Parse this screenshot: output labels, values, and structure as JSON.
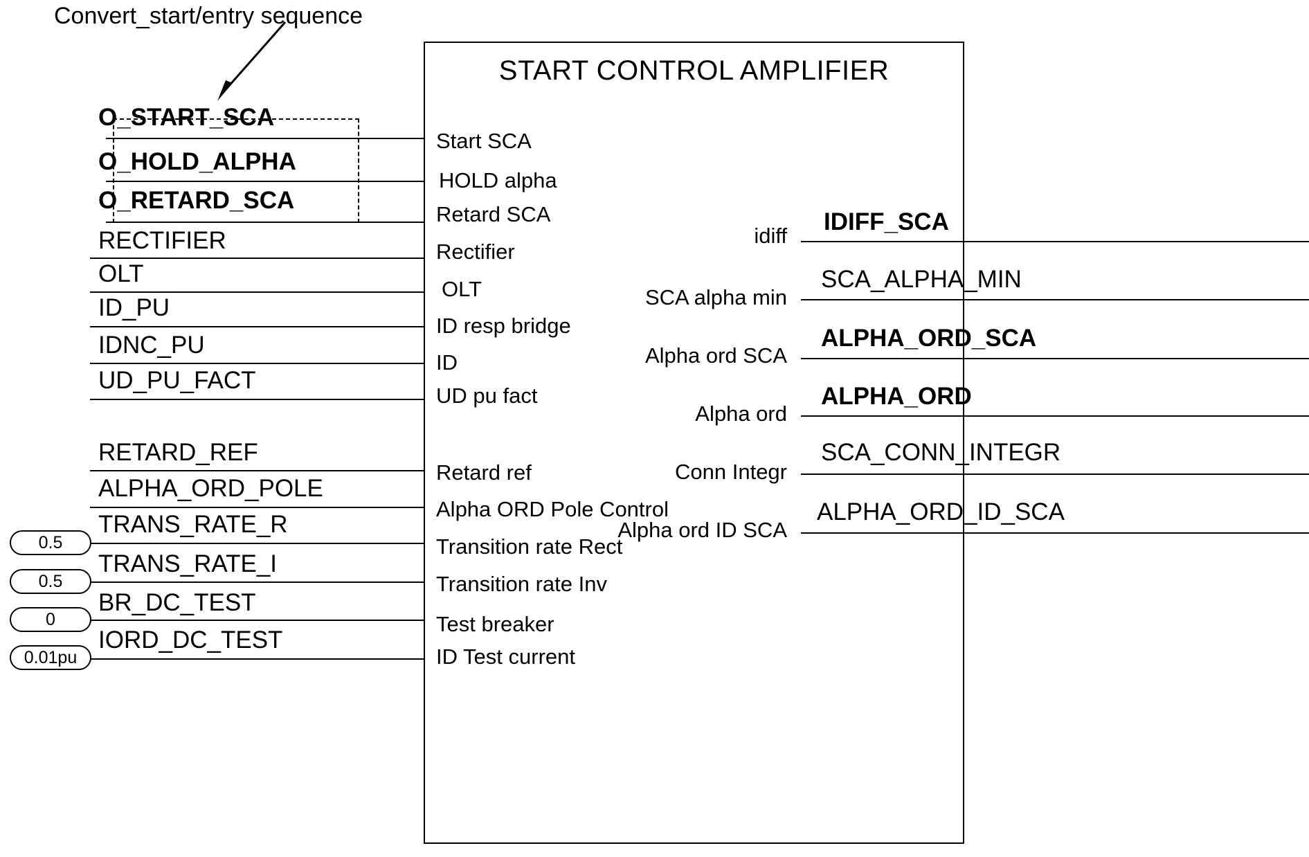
{
  "annotation": {
    "text": "Convert_start/entry sequence"
  },
  "block": {
    "title": "START CONTROL AMPLIFIER"
  },
  "inputs": [
    {
      "signal": "O_START_SCA",
      "port": "Start SCA",
      "bold": true,
      "grouped": true
    },
    {
      "signal": "O_HOLD_ALPHA",
      "port": "HOLD alpha",
      "bold": true,
      "grouped": true
    },
    {
      "signal": "O_RETARD_SCA",
      "port": "Retard SCA",
      "bold": true,
      "grouped": true
    },
    {
      "signal": "RECTIFIER",
      "port": "Rectifier",
      "bold": false,
      "grouped": false
    },
    {
      "signal": "OLT",
      "port": "OLT",
      "bold": false,
      "grouped": false
    },
    {
      "signal": "ID_PU",
      "port": "ID resp bridge",
      "bold": false,
      "grouped": false
    },
    {
      "signal": "IDNC_PU",
      "port": "ID",
      "bold": false,
      "grouped": false
    },
    {
      "signal": "UD_PU_FACT",
      "port": "UD pu fact",
      "bold": false,
      "grouped": false
    },
    {
      "signal": "RETARD_REF",
      "port": "Retard ref",
      "bold": false,
      "grouped": false
    },
    {
      "signal": "ALPHA_ORD_POLE",
      "port": "Alpha ORD Pole Control",
      "bold": false,
      "grouped": false
    },
    {
      "signal": "TRANS_RATE_R",
      "port": "Transition rate Rect",
      "bold": false,
      "grouped": false,
      "value": "0.5"
    },
    {
      "signal": "TRANS_RATE_I",
      "port": "Transition rate Inv",
      "bold": false,
      "grouped": false,
      "value": "0.5"
    },
    {
      "signal": "BR_DC_TEST",
      "port": "Test breaker",
      "bold": false,
      "grouped": false,
      "value": "0"
    },
    {
      "signal": "IORD_DC_TEST",
      "port": "ID Test current",
      "bold": false,
      "grouped": false,
      "value": "0.01pu"
    }
  ],
  "outputs": [
    {
      "signal": "IDIFF_SCA",
      "port": "idiff",
      "bold": true
    },
    {
      "signal": "SCA_ALPHA_MIN",
      "port": "SCA alpha min",
      "bold": false
    },
    {
      "signal": "ALPHA_ORD_SCA",
      "port": "Alpha ord SCA",
      "bold": true
    },
    {
      "signal": "ALPHA_ORD",
      "port": "Alpha ord",
      "bold": true
    },
    {
      "signal": "SCA_CONN_INTEGR",
      "port": "Conn Integr",
      "bold": false
    },
    {
      "signal": "ALPHA_ORD_ID_SCA",
      "port": "Alpha ord ID SCA",
      "bold": false
    }
  ],
  "colors": {
    "stroke": "#000000",
    "background": "#ffffff"
  }
}
